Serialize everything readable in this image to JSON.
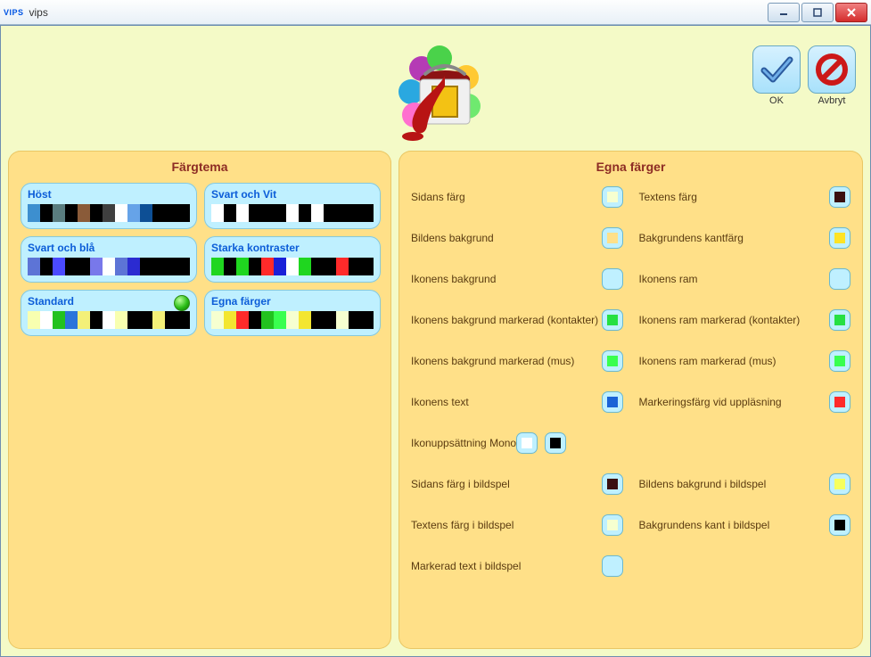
{
  "window": {
    "app_icon_text": "VIPS",
    "title": "vips"
  },
  "actions": {
    "ok": "OK",
    "cancel": "Avbryt"
  },
  "themes_heading": "Färgtema",
  "custom_heading": "Egna färger",
  "themes": [
    {
      "name": "Höst",
      "swatches": [
        "#3d8fcf",
        "#000000",
        "#5a7d7f",
        "#000000",
        "#8a5b39",
        "#000000",
        "#3f3f3f",
        "#ffffff",
        "#66a3e8",
        "#0d4f95",
        "#000000",
        "#000000",
        "#000000"
      ],
      "selected": false
    },
    {
      "name": "Svart och Vit",
      "swatches": [
        "#ffffff",
        "#000000",
        "#ffffff",
        "#000000",
        "#000000",
        "#000000",
        "#ffffff",
        "#000000",
        "#ffffff",
        "#000000",
        "#000000",
        "#000000",
        "#000000"
      ],
      "selected": false
    },
    {
      "name": "Svart och blå",
      "swatches": [
        "#5d74d6",
        "#000000",
        "#4a4aff",
        "#000000",
        "#000000",
        "#7878ea",
        "#ffffff",
        "#5d74d6",
        "#2b2bd1",
        "#000000",
        "#000000",
        "#000000",
        "#000000"
      ],
      "selected": false
    },
    {
      "name": "Starka kontraster",
      "swatches": [
        "#1fd61f",
        "#000000",
        "#1fd61f",
        "#000000",
        "#ff2a2a",
        "#1a20d8",
        "#ffffff",
        "#1fd61f",
        "#000000",
        "#000000",
        "#ff2a2a",
        "#000000",
        "#000000"
      ],
      "selected": false
    },
    {
      "name": "Standard",
      "swatches": [
        "#f8ffb0",
        "#ffffff",
        "#22c21f",
        "#2b74db",
        "#f3f078",
        "#000000",
        "#ffffff",
        "#f8ffb0",
        "#000000",
        "#000000",
        "#f3f078",
        "#000000",
        "#000000"
      ],
      "selected": true
    },
    {
      "name": "Egna färger",
      "swatches": [
        "#f6ffd0",
        "#f3e630",
        "#ff2a2a",
        "#000000",
        "#22c21f",
        "#39ff4f",
        "#f6ffd0",
        "#f3e630",
        "#000000",
        "#000000",
        "#f6ffd0",
        "#000000",
        "#000000"
      ],
      "selected": false
    }
  ],
  "color_rows": [
    {
      "left": {
        "label": "Sidans färg",
        "color": "#f6ffd0"
      },
      "right": {
        "label": "Textens färg",
        "color": "#3a1010"
      }
    },
    {
      "left": {
        "label": "Bildens bakgrund",
        "color": "#ffe088"
      },
      "right": {
        "label": "Bakgrundens kantfärg",
        "color": "#ffe325"
      }
    },
    {
      "left": {
        "label": "Ikonens bakgrund",
        "color": "#bff0ff"
      },
      "right": {
        "label": "Ikonens ram",
        "color": "#bff0ff"
      }
    },
    {
      "left": {
        "label": "Ikonens bakgrund markerad (kontakter)",
        "color": "#26e042"
      },
      "right": {
        "label": "Ikonens ram markerad (kontakter)",
        "color": "#26e042"
      }
    },
    {
      "left": {
        "label": "Ikonens bakgrund markerad (mus)",
        "color": "#39ff4f"
      },
      "right": {
        "label": "Ikonens ram markerad (mus)",
        "color": "#39ff4f"
      }
    },
    {
      "left": {
        "label": "Ikonens text",
        "color": "#1a63d6"
      },
      "right": {
        "label": "Markeringsfärg vid uppläsning",
        "color": "#ff2a2a"
      }
    }
  ],
  "mono_row": {
    "label": "Ikonuppsättning Mono",
    "colors": [
      "#ffffff",
      "#000000"
    ]
  },
  "slideshow_rows": [
    {
      "left": {
        "label": "Sidans färg i bildspel",
        "color": "#3a1010"
      },
      "right": {
        "label": "Bildens bakgrund i bildspel",
        "color": "#f7ff5d"
      }
    },
    {
      "left": {
        "label": "Textens färg i bildspel",
        "color": "#f6ffd0"
      },
      "right": {
        "label": "Bakgrundens kant i bildspel",
        "color": "#000000"
      }
    },
    {
      "left": {
        "label": "Markerad text i bildspel",
        "color": "#bff0ff"
      }
    }
  ]
}
